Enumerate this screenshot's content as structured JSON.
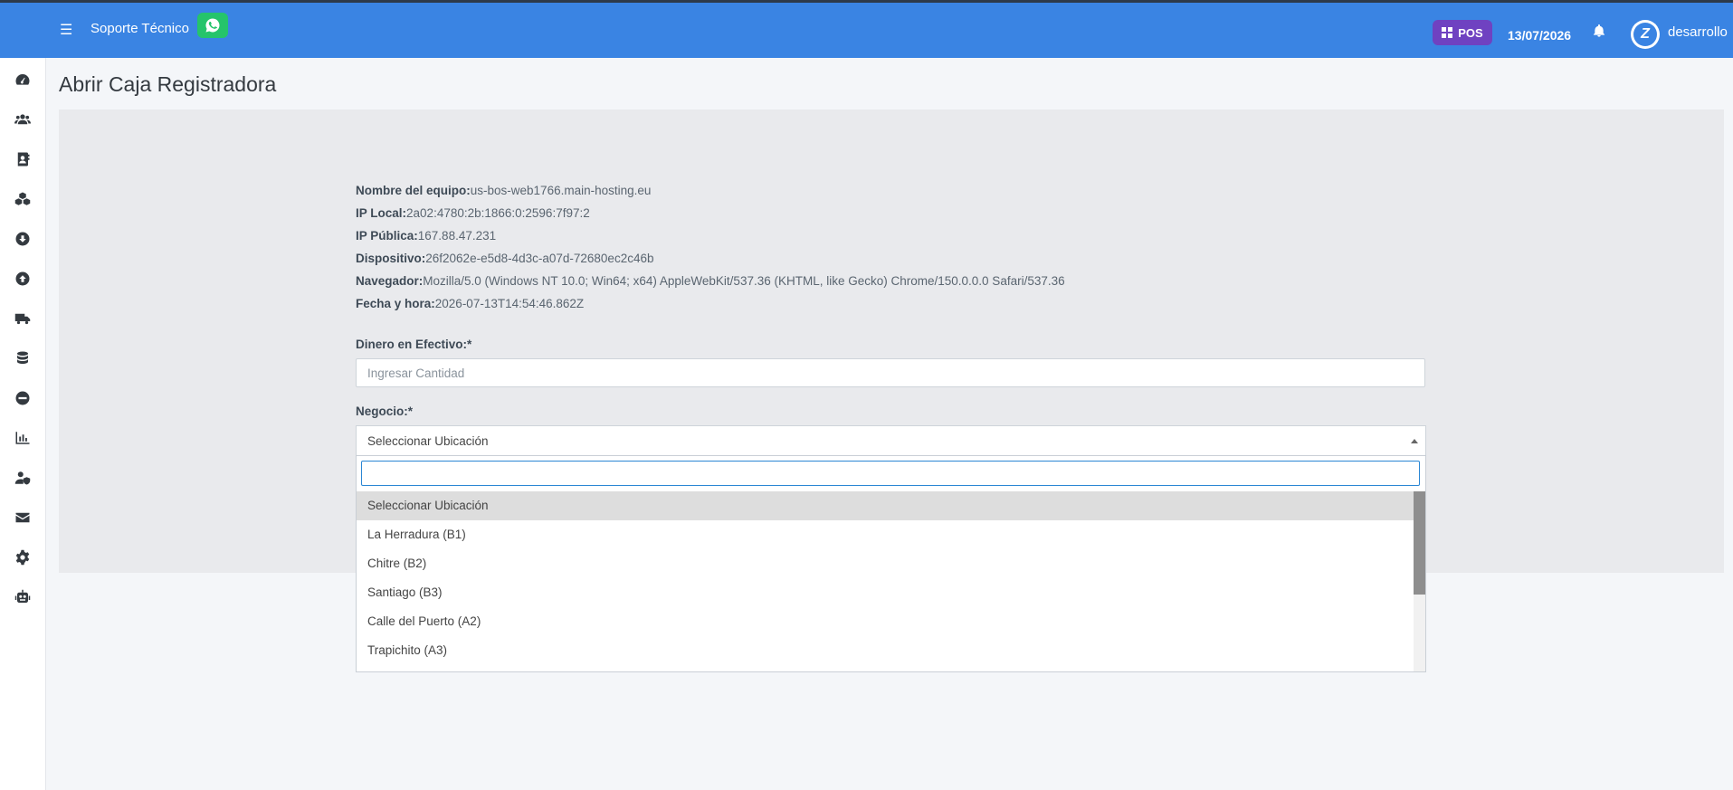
{
  "topbar": {
    "support_label": "Soporte Técnico",
    "pos_label": "POS",
    "date": "13/07/2026",
    "username": "desarrollo"
  },
  "sidebar": {
    "icons": [
      "dashboard-icon",
      "users-icon",
      "contacts-icon",
      "products-icon",
      "download-icon",
      "upload-icon",
      "truck-icon",
      "database-icon",
      "minus-circle-icon",
      "chart-icon",
      "user-shield-icon",
      "envelope-icon",
      "gear-icon",
      "robot-icon"
    ]
  },
  "page": {
    "title": "Abrir Caja Registradora"
  },
  "info": {
    "equipo_label": "Nombre del equipo:",
    "equipo_value": "us-bos-web1766.main-hosting.eu",
    "ip_local_label": "IP Local:",
    "ip_local_value": "2a02:4780:2b:1866:0:2596:7f97:2",
    "ip_publica_label": "IP Pública:",
    "ip_publica_value": "167.88.47.231",
    "dispositivo_label": "Dispositivo:",
    "dispositivo_value": "26f2062e-e5d8-4d3c-a07d-72680ec2c46b",
    "navegador_label": "Navegador:",
    "navegador_value": "Mozilla/5.0 (Windows NT 10.0; Win64; x64) AppleWebKit/537.36 (KHTML, like Gecko) Chrome/150.0.0.0 Safari/537.36",
    "fecha_label": "Fecha y hora:",
    "fecha_value": "2026-07-13T14:54:46.862Z"
  },
  "form": {
    "cash_label": "Dinero en Efectivo:*",
    "cash_placeholder": "Ingresar Cantidad",
    "business_label": "Negocio:*",
    "business_selected": "Seleccionar Ubicación",
    "options": [
      "Seleccionar Ubicación",
      "La Herradura (B1)",
      "Chitre (B2)",
      "Santiago (B3)",
      "Calle del Puerto (A2)",
      "Trapichito (A3)"
    ]
  },
  "colors": {
    "primary": "#3a84e3",
    "whatsapp": "#25c46b",
    "pos": "#6f42c1"
  }
}
